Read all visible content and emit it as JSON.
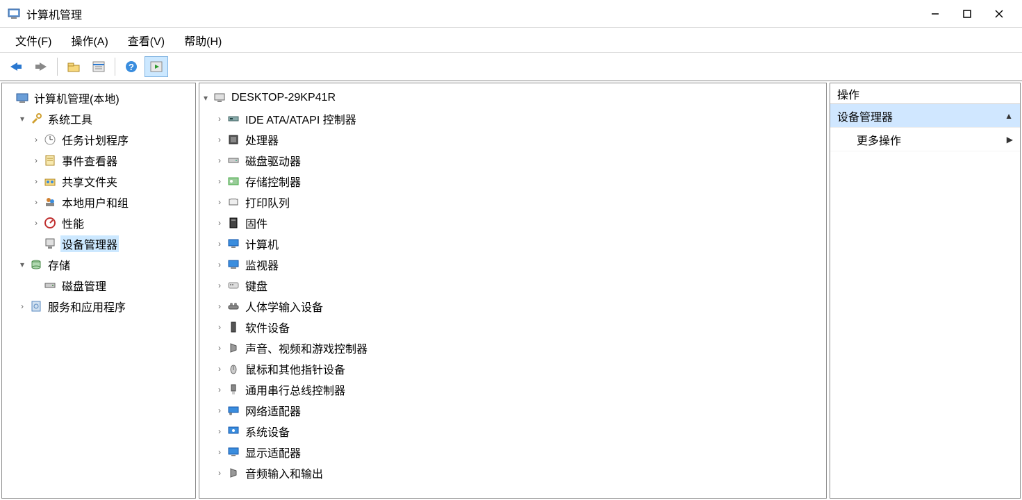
{
  "window": {
    "title": "计算机管理"
  },
  "menu": [
    "文件(F)",
    "操作(A)",
    "查看(V)",
    "帮助(H)"
  ],
  "left_tree": {
    "root": "计算机管理(本地)",
    "system_tools": {
      "label": "系统工具",
      "items": [
        "任务计划程序",
        "事件查看器",
        "共享文件夹",
        "本地用户和组",
        "性能",
        "设备管理器"
      ]
    },
    "storage": {
      "label": "存储",
      "items": [
        "磁盘管理"
      ]
    },
    "services": "服务和应用程序"
  },
  "devices": {
    "root": "DESKTOP-29KP41R",
    "items": [
      "IDE ATA/ATAPI 控制器",
      "处理器",
      "磁盘驱动器",
      "存储控制器",
      "打印队列",
      "固件",
      "计算机",
      "监视器",
      "键盘",
      "人体学输入设备",
      "软件设备",
      "声音、视频和游戏控制器",
      "鼠标和其他指针设备",
      "通用串行总线控制器",
      "网络适配器",
      "系统设备",
      "显示适配器",
      "音频输入和输出"
    ]
  },
  "right_panel": {
    "header": "操作",
    "section": "设备管理器",
    "more": "更多操作"
  }
}
